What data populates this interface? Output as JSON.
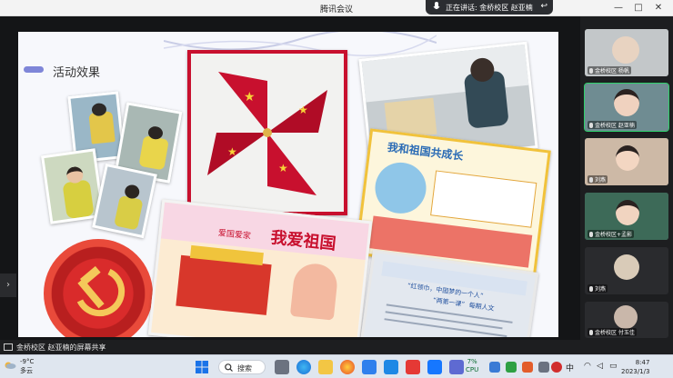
{
  "window": {
    "title": "腾讯会议",
    "speaking": "正在讲话: 金桥校区 赵亚楠",
    "minimize": "—",
    "maximize": "□",
    "close": "✕"
  },
  "slide": {
    "title": "活动效果",
    "poster_top_title": "我和祖国共成长",
    "poster_bottom_title": "我爱祖国",
    "poster_bottom_subtitle": "爱国爱家",
    "doc_lines": [
      "“红领巾，中国梦的一个人”",
      "“两第一课”",
      "每期人文"
    ]
  },
  "participants": [
    {
      "name": "金桥校区 杨帆",
      "active": false,
      "bg": "#b8bdc0"
    },
    {
      "name": "金桥校区 赵亚楠",
      "active": true,
      "bg": "#6f8c92"
    },
    {
      "name": "刘燕",
      "active": false,
      "bg": "#c9b6a3"
    },
    {
      "name": "金桥校区+孟影",
      "active": false,
      "bg": "#3d6a58"
    },
    {
      "name": "刘燕",
      "active": false,
      "bg": "#2a2b2e"
    },
    {
      "name": "金桥校区 付玉佳",
      "active": false,
      "bg": "#2a2b2e"
    }
  ],
  "share_banner": "金桥校区 赵亚楠的屏幕共享",
  "taskbar": {
    "weather_temp": "-9°C",
    "weather_desc": "多云",
    "search_label": "搜索",
    "cpu_pct": "7%",
    "cpu_label": "CPU",
    "ime_label": "中",
    "time": "8:47",
    "date": "2023/1/3"
  }
}
